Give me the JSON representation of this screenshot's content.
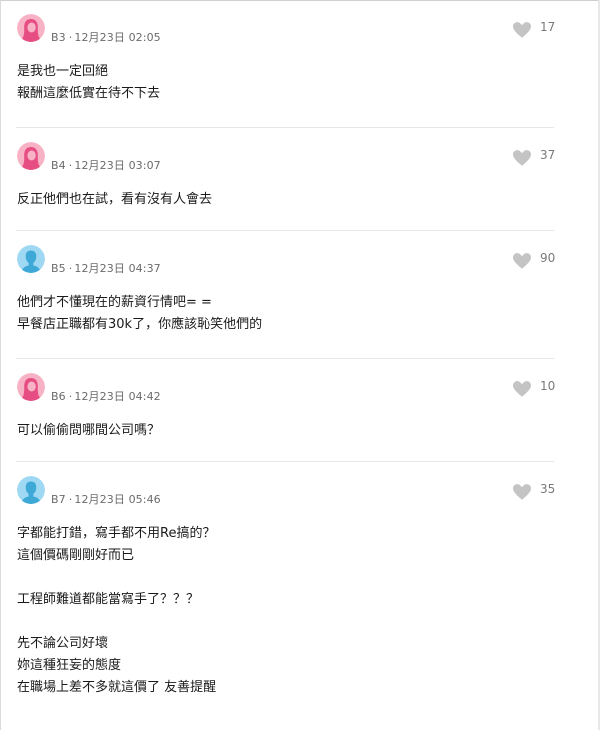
{
  "colors": {
    "female_avatar_bg": "#f7b3c5",
    "female_avatar_fg": "#e64e83",
    "male_avatar_bg": "#9fd8f2",
    "male_avatar_fg": "#3ea9d7",
    "heart": "#c4c4c4",
    "meta_text": "#6b6b6b"
  },
  "comments": [
    {
      "floor": "B3",
      "date": "12月23日",
      "time": "02:05",
      "likes": "17",
      "avatar": "female-avatar-icon",
      "lines": [
        "是我也一定回絕",
        "報酬這麼低實在待不下去"
      ]
    },
    {
      "floor": "B4",
      "date": "12月23日",
      "time": "03:07",
      "likes": "37",
      "avatar": "female-avatar-icon",
      "lines": [
        "反正他們也在試，看有沒有人會去"
      ]
    },
    {
      "floor": "B5",
      "date": "12月23日",
      "time": "04:37",
      "likes": "90",
      "avatar": "male-avatar-icon",
      "lines": [
        "他們才不懂現在的薪資行情吧= =",
        "早餐店正職都有30k了，你應該恥笑他們的"
      ]
    },
    {
      "floor": "B6",
      "date": "12月23日",
      "time": "04:42",
      "likes": "10",
      "avatar": "female-avatar-icon",
      "lines": [
        "可以偷偷問哪間公司嗎？"
      ]
    },
    {
      "floor": "B7",
      "date": "12月23日",
      "time": "05:46",
      "likes": "35",
      "avatar": "male-avatar-icon",
      "lines": [
        "字都能打錯，寫手都不用Re搞的？",
        "這個價碼剛剛好而已",
        "",
        "工程師難道都能當寫手了？？？",
        "",
        "先不論公司好壞",
        "妳這種狂妄的態度",
        "在職場上差不多就這價了 友善提醒"
      ]
    }
  ]
}
